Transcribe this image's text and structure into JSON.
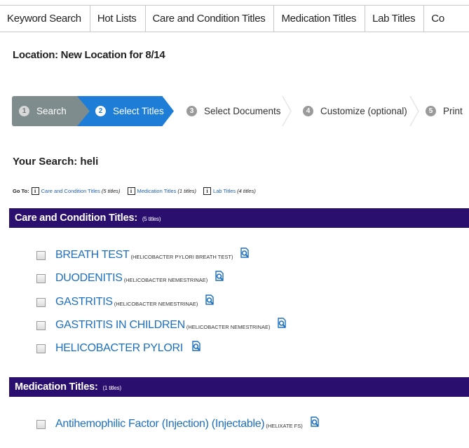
{
  "tabs": [
    "Keyword Search",
    "Hot Lists",
    "Care and Condition Titles",
    "Medication Titles",
    "Lab Titles",
    "Co"
  ],
  "location": "Location:  New Location for 8/14",
  "wizard": {
    "steps": [
      {
        "num": "1",
        "label": "Search"
      },
      {
        "num": "2",
        "label": "Select Titles"
      },
      {
        "num": "3",
        "label": "Select Documents"
      },
      {
        "num": "4",
        "label": "Customize (optional)"
      },
      {
        "num": "5",
        "label": "Print"
      }
    ],
    "active_step": 2
  },
  "your_search": "Your Search:  heli",
  "goto": {
    "label": "Go To:",
    "links": [
      {
        "text": "Care and Condition Titles",
        "count": "(5 titles)"
      },
      {
        "text": "Medication Titles",
        "count": "(1 titles)"
      },
      {
        "text": "Lab Titles",
        "count": "(4 titles)"
      }
    ]
  },
  "sections": [
    {
      "title": "Care and Condition Titles:",
      "count": "(5 titles)",
      "items": [
        {
          "title": "BREATH TEST",
          "sub": "(HELICOBACTER PYLORI BREATH TEST)"
        },
        {
          "title": "DUODENITIS",
          "sub": "(HELICOBACTER NEMESTRINAE)"
        },
        {
          "title": "GASTRITIS",
          "sub": "(HELICOBACTER NEMESTRINAE)"
        },
        {
          "title": "GASTRITIS IN CHILDREN",
          "sub": "(HELICOBACTER NEMESTRINAE)"
        },
        {
          "title": "HELICOBACTER PYLORI",
          "sub": ""
        }
      ]
    },
    {
      "title": "Medication Titles:",
      "count": "(1 titles)",
      "items": [
        {
          "title": "Antihemophilic Factor (Injection) (Injectable)",
          "sub": "(HELIXATE FS)"
        }
      ]
    }
  ],
  "colors": {
    "section_bar": "#2b0f6e",
    "active_step": "#1d7dd7",
    "done_step": "#7f8c8d",
    "link": "#1d6fbf"
  },
  "icons": {
    "preview": "magnifier-document-icon",
    "info": "info-icon"
  }
}
